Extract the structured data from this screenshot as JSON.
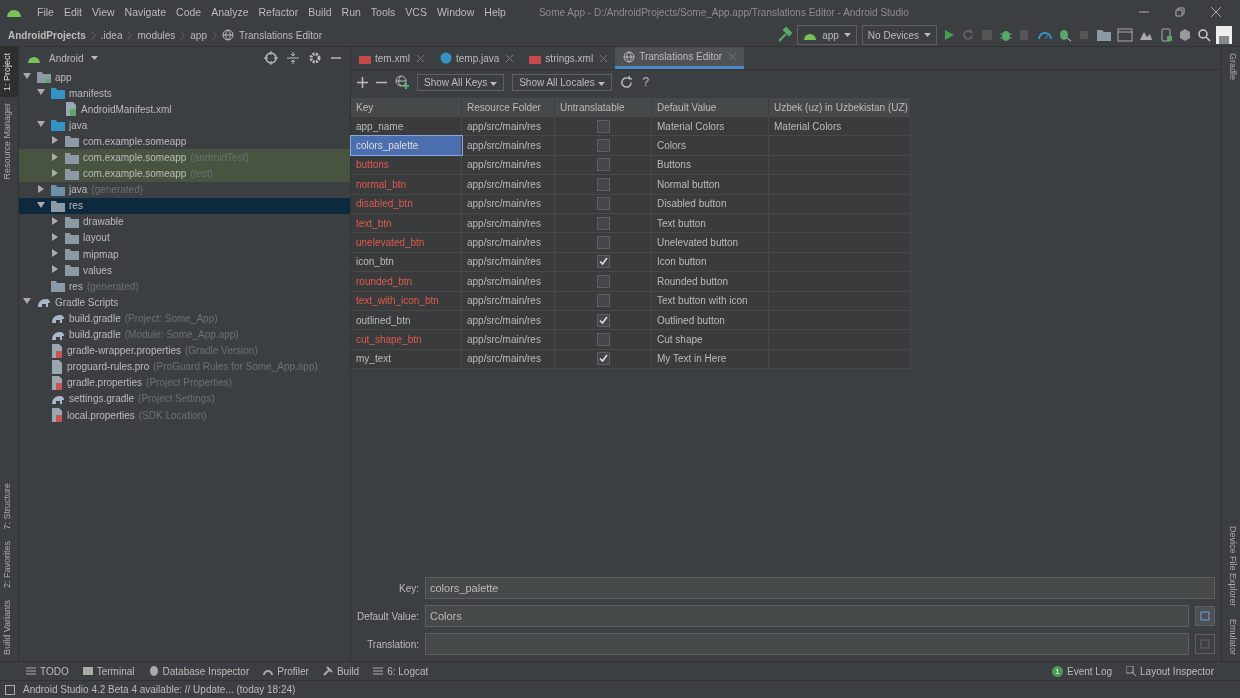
{
  "menu": [
    "File",
    "Edit",
    "View",
    "Navigate",
    "Code",
    "Analyze",
    "Refactor",
    "Build",
    "Run",
    "Tools",
    "VCS",
    "Window",
    "Help"
  ],
  "window": {
    "title": "Some App - D:/AndroidProjects/Some_App.app/Translations Editor - Android Studio"
  },
  "breadcrumbs": [
    "AndroidProjects",
    ".idea",
    "modules",
    "app",
    "Translations Editor"
  ],
  "run_config": {
    "module": "app",
    "device": "No Devices"
  },
  "left_tool_windows": [
    {
      "label": "1: Project",
      "selected": true
    },
    {
      "label": "Resource Manager",
      "selected": false
    },
    {
      "label": "7: Structure",
      "selected": false
    },
    {
      "label": "2: Favorites",
      "selected": false
    },
    {
      "label": "Build Variants",
      "selected": false
    }
  ],
  "right_tool_windows": [
    "Gradle",
    "Device File Explorer",
    "Emulator"
  ],
  "project": {
    "view": "Android",
    "tree": [
      {
        "label": "app",
        "kind": "module",
        "expanded": true,
        "selected": false,
        "test_source": false,
        "children": [
          {
            "label": "manifests",
            "kind": "folder",
            "expanded": true,
            "selected": false,
            "test_source": false,
            "children": [
              {
                "label": "AndroidManifest.xml",
                "kind": "manifest",
                "selected": false,
                "test_source": false
              }
            ]
          },
          {
            "label": "java",
            "kind": "folder",
            "expanded": true,
            "selected": false,
            "test_source": false,
            "children": [
              {
                "label": "com.example.someapp",
                "kind": "package",
                "expanded": false,
                "selected": false,
                "test_source": false
              },
              {
                "label": "com.example.someapp",
                "note": "(androidTest)",
                "kind": "package",
                "expanded": false,
                "selected": false,
                "test_source": true
              },
              {
                "label": "com.example.someapp",
                "note": "(test)",
                "kind": "package",
                "expanded": false,
                "selected": false,
                "test_source": true
              }
            ]
          },
          {
            "label": "java",
            "note": "(generated)",
            "kind": "generated",
            "expanded": false,
            "selected": false,
            "test_source": false
          },
          {
            "label": "res",
            "kind": "resources",
            "expanded": true,
            "selected": true,
            "test_source": false,
            "children": [
              {
                "label": "drawable",
                "kind": "package",
                "expanded": false,
                "selected": false,
                "test_source": false
              },
              {
                "label": "layout",
                "kind": "package",
                "expanded": false,
                "selected": false,
                "test_source": false
              },
              {
                "label": "mipmap",
                "kind": "package",
                "expanded": false,
                "selected": false,
                "test_source": false
              },
              {
                "label": "values",
                "kind": "package",
                "expanded": false,
                "selected": false,
                "test_source": false
              }
            ]
          },
          {
            "label": "res",
            "note": "(generated)",
            "kind": "resources",
            "selected": false,
            "test_source": false
          }
        ]
      },
      {
        "label": "Gradle Scripts",
        "kind": "gradle",
        "expanded": true,
        "selected": false,
        "test_source": false,
        "children": [
          {
            "label": "build.gradle",
            "note": "(Project: Some_App)",
            "kind": "gradle",
            "selected": false,
            "test_source": false
          },
          {
            "label": "build.gradle",
            "note": "(Module: Some_App.app)",
            "kind": "gradle",
            "selected": false,
            "test_source": false
          },
          {
            "label": "gradle-wrapper.properties",
            "note": "(Gradle Version)",
            "kind": "properties",
            "selected": false,
            "test_source": false
          },
          {
            "label": "proguard-rules.pro",
            "note": "(ProGuard Rules for Some_App.app)",
            "kind": "text",
            "selected": false,
            "test_source": false
          },
          {
            "label": "gradle.properties",
            "note": "(Project Properties)",
            "kind": "properties",
            "selected": false,
            "test_source": false
          },
          {
            "label": "settings.gradle",
            "note": "(Project Settings)",
            "kind": "gradle",
            "selected": false,
            "test_source": false
          },
          {
            "label": "local.properties",
            "note": "(SDK Location)",
            "kind": "properties",
            "selected": false,
            "test_source": false
          }
        ]
      }
    ]
  },
  "tabs": [
    {
      "label": "tem.xml",
      "kind": "xml",
      "selected": false
    },
    {
      "label": "temp.java",
      "kind": "java",
      "selected": false
    },
    {
      "label": "strings.xml",
      "kind": "xml",
      "selected": false
    },
    {
      "label": "Translations Editor",
      "kind": "globe",
      "selected": true
    }
  ],
  "editor_toolbar": {
    "key_filter": "Show All Keys",
    "locale_filter": "Show All Locales",
    "help": "?"
  },
  "table": {
    "columns": [
      "Key",
      "Resource Folder",
      "Untranslatable",
      "Default Value",
      "Uzbek (uz) in Uzbekistan (UZ)"
    ],
    "rows": [
      {
        "key": "app_name",
        "folder": "app/src/main/res",
        "untranslatable": false,
        "default": "Material Colors",
        "translation": "Material Colors",
        "missing": false,
        "selected": false
      },
      {
        "key": "colors_palette",
        "folder": "app/src/main/res",
        "untranslatable": false,
        "default": "Colors",
        "missing": false,
        "selected": true
      },
      {
        "key": "buttons",
        "folder": "app/src/main/res",
        "untranslatable": false,
        "default": "Buttons",
        "missing": true,
        "selected": false
      },
      {
        "key": "normal_btn",
        "folder": "app/src/main/res",
        "untranslatable": false,
        "default": "Normal button",
        "missing": true,
        "selected": false
      },
      {
        "key": "disabled_btn",
        "folder": "app/src/main/res",
        "untranslatable": false,
        "default": "Disabled button",
        "missing": true,
        "selected": false
      },
      {
        "key": "text_btn",
        "folder": "app/src/main/res",
        "untranslatable": false,
        "default": "Text button",
        "missing": true,
        "selected": false
      },
      {
        "key": "unelevated_btn",
        "folder": "app/src/main/res",
        "untranslatable": false,
        "default": "Unelevated button",
        "missing": true,
        "selected": false
      },
      {
        "key": "icon_btn",
        "folder": "app/src/main/res",
        "untranslatable": true,
        "default": "Icon button",
        "missing": false,
        "selected": false
      },
      {
        "key": "rounded_btn",
        "folder": "app/src/main/res",
        "untranslatable": false,
        "default": "Rounded button",
        "missing": true,
        "selected": false
      },
      {
        "key": "text_with_icon_btn",
        "folder": "app/src/main/res",
        "untranslatable": false,
        "default": "Text button with icon",
        "missing": true,
        "selected": false
      },
      {
        "key": "outlined_btn",
        "folder": "app/src/main/res",
        "untranslatable": true,
        "default": "Outlined button",
        "missing": false,
        "selected": false
      },
      {
        "key": "cut_shape_btn",
        "folder": "app/src/main/res",
        "untranslatable": false,
        "default": "Cut shape",
        "missing": true,
        "selected": false
      },
      {
        "key": "my_text",
        "folder": "app/src/main/res",
        "untranslatable": true,
        "default": "My Text in Here",
        "missing": false,
        "selected": false
      }
    ]
  },
  "form": [
    {
      "label": "Key:",
      "value": "colors_palette"
    },
    {
      "label": "Default Value:",
      "value": "Colors"
    },
    {
      "label": "Translation:"
    }
  ],
  "bottom_tools": [
    {
      "label": "TODO",
      "kind": "list"
    },
    {
      "label": "Terminal",
      "kind": "terminal"
    },
    {
      "label": "Database Inspector",
      "kind": "database"
    },
    {
      "label": "Profiler",
      "kind": "gauge"
    },
    {
      "label": "Build",
      "kind": "hammer"
    },
    {
      "label": "6: Logcat",
      "kind": "list"
    }
  ],
  "event_log": {
    "label": "Event Log",
    "count": "1"
  },
  "layout_inspector": "Layout Inspector",
  "status": "Android Studio 4.2 Beta 4 available: // Update... (today 18:24)"
}
